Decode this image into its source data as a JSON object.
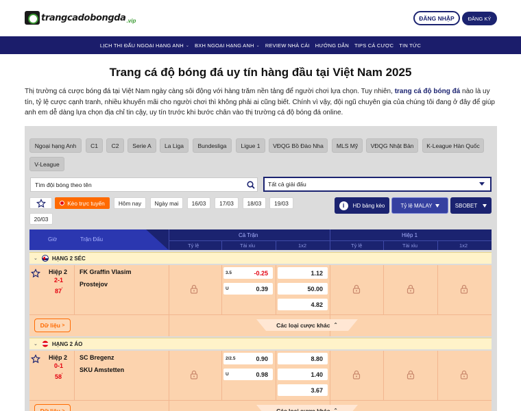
{
  "brand": {
    "name": "trangcadobongda",
    "tld": ".vip"
  },
  "header": {
    "login": "ĐĂNG NHẬP",
    "register": "ĐĂNG KÝ"
  },
  "nav": [
    {
      "label": "LỊCH THI ĐẤU NGOẠI HẠNG ANH",
      "dropdown": true
    },
    {
      "label": "BXH NGOẠI HẠNG ANH",
      "dropdown": true
    },
    {
      "label": "REVIEW NHÀ CÁI",
      "dropdown": false
    },
    {
      "label": "HƯỚNG DẪN",
      "dropdown": false
    },
    {
      "label": "TIPS CÁ CƯỢC",
      "dropdown": false
    },
    {
      "label": "TIN TỨC",
      "dropdown": false
    }
  ],
  "page": {
    "title": "Trang cá độ bóng đá uy tín hàng đầu tại Việt Nam 2025",
    "intro_a": "Thị trường cá cược bóng đá tại Việt Nam ngày càng sôi động với hàng trăm nền tảng để người chơi lựa chọn. Tuy nhiên, ",
    "intro_link": "trang cá độ bóng đá",
    "intro_b": " nào là uy tín, tỷ lệ cược cạnh tranh, nhiều khuyến mãi cho người chơi thì không phải ai cũng biết. Chính vì vậy, đội ngũ chuyên gia của chúng tôi đang ở đây để giúp anh em dễ dàng lựa chọn địa chỉ tin cậy, uy tín trước khi bước chân vào thị trường cá độ bóng đá online."
  },
  "leagues": [
    "Ngoại hạng Anh",
    "C1",
    "C2",
    "Serie A",
    "La Liga",
    "Bundesliga",
    "Ligue 1",
    "VĐQG Bồ Đào Nha",
    "MLS Mỹ",
    "VĐQG Nhật Bản",
    "K-League Hàn Quốc",
    "V-League"
  ],
  "filters": {
    "search_placeholder": "Tìm đội bóng theo tên",
    "tournament": "Tất cả giải đấu",
    "live": "Kèo trực tuyến",
    "dates": [
      "Hôm nay",
      "Ngày mai",
      "16/03",
      "17/03",
      "18/03",
      "19/03",
      "20/03"
    ],
    "hd_label": "HD bảng kèo",
    "odds_type": "Tỷ lệ MALAY",
    "bookmaker": "SBOBET"
  },
  "table": {
    "col_time": "Giờ",
    "col_match": "Trận Đấu",
    "full_match": "Cả Trận",
    "half1": "Hiệp 1",
    "sub": [
      "Tỷ lệ",
      "Tài xỉu",
      "1x2",
      "Tỷ lệ",
      "Tài xỉu",
      "1x2"
    ],
    "more_label": "Các loại cược khác",
    "data_label": "Dữ liệu"
  },
  "matches": [
    {
      "league": "HẠNG 2 SÉC",
      "status": "Hiệp 2",
      "score": "2-1",
      "minute": "87",
      "home": "FK Graffin Vlasim",
      "away": "Prostejov",
      "hdp_line": "3.5",
      "hdp_home": "-0.25",
      "hdp_away": "0.39",
      "ou_line": "U",
      "x12": [
        "1.12",
        "50.00",
        "4.82"
      ]
    },
    {
      "league": "HẠNG 2 ÁO",
      "status": "Hiệp 2",
      "score": "0-1",
      "minute": "58",
      "home": "SC Bregenz",
      "away": "SKU Amstetten",
      "hdp_line": "2/2.5",
      "hdp_home": "0.90",
      "hdp_away": "0.98",
      "ou_line": "U",
      "x12": [
        "8.80",
        "1.40",
        "3.67"
      ]
    }
  ],
  "colors": {
    "navy": "#1b2370",
    "orange": "#ff6a00",
    "row": "#fcd3ae",
    "league_row": "#fff3c9",
    "red": "#e3000f"
  }
}
